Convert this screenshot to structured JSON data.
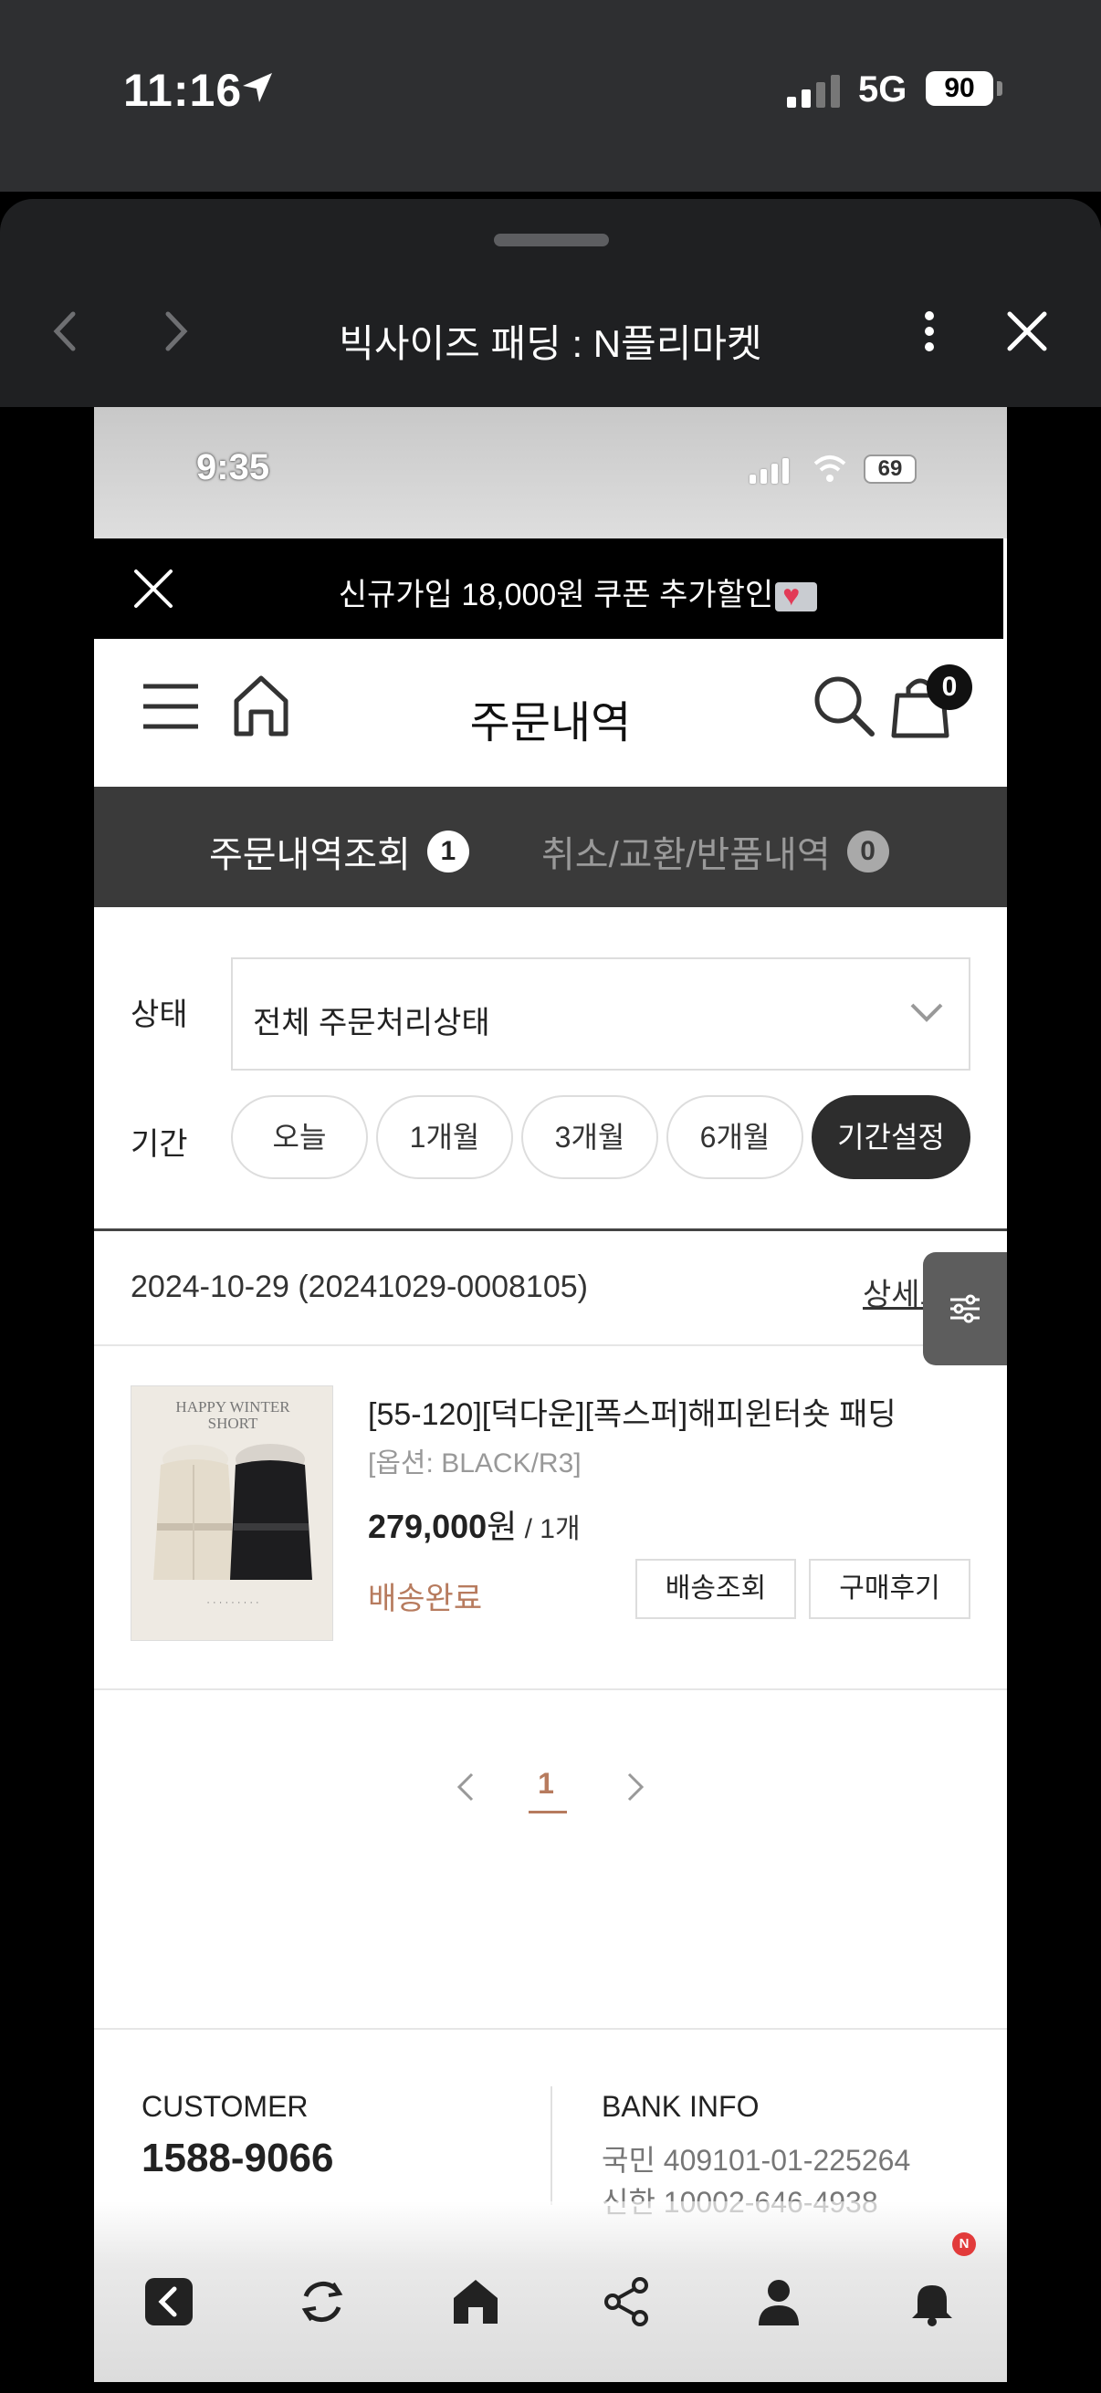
{
  "os_status": {
    "time": "11:16",
    "network": "5G",
    "battery": "90"
  },
  "browser": {
    "title": "빅사이즈 패딩 : N플리마켓"
  },
  "inner_status": {
    "time": "9:35",
    "battery": "69"
  },
  "promo": {
    "text": "신규가입 18,000원 쿠폰 추가할인"
  },
  "header": {
    "title": "주문내역",
    "cart_count": "0"
  },
  "tabs": [
    {
      "label": "주문내역조회",
      "count": "1"
    },
    {
      "label": "취소/교환/반품내역",
      "count": "0"
    }
  ],
  "filters": {
    "status_label": "상태",
    "status_value": "전체 주문처리상태",
    "period_label": "기간",
    "periods": [
      "오늘",
      "1개월",
      "3개월",
      "6개월",
      "기간설정"
    ]
  },
  "order": {
    "date_no": "2024-10-29 (20241029-0008105)",
    "detail_link": "상세보기"
  },
  "product": {
    "thumb_title_1": "HAPPY WINTER",
    "thumb_title_2": "SHORT",
    "name": "[55-120][덕다운][폭스퍼]해피윈터숏 패딩",
    "option": "[옵션: BLACK/R3]",
    "price": "279,000",
    "price_unit": "원",
    "qty": " / 1개",
    "status": "배송완료",
    "btn_track": "배송조회",
    "btn_review": "구매후기"
  },
  "pagination": {
    "current": "1"
  },
  "footer": {
    "customer_label": "CUSTOMER",
    "phone": "1588-9066",
    "bank_label": "BANK INFO",
    "bank_lines": [
      "국민 409101-01-225264",
      "신한 10002-646-4938"
    ]
  },
  "bottom_bar": {
    "notif_badge": "N"
  },
  "colors": {
    "accent": "#b77b5e",
    "dark": "#2d2d2d",
    "tab_bg": "#3a3a3a"
  }
}
